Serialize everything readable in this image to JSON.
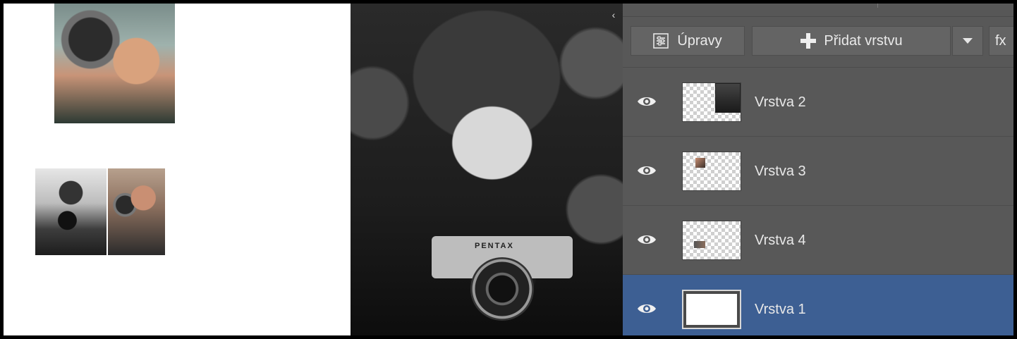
{
  "toolbar": {
    "adjust_label": "Úpravy",
    "add_layer_label": "Přidat vrstvu",
    "fx_label": "fx",
    "icons": [
      "adjustments-icon",
      "plus-icon",
      "chevron-down-icon"
    ]
  },
  "canvas": {
    "collapse_icon": "chevron-left-icon",
    "collapse_glyph": "‹",
    "camera_brand": "PENTAX"
  },
  "layers": [
    {
      "name": "Vrstva 2",
      "visible": true,
      "selected": false
    },
    {
      "name": "Vrstva 3",
      "visible": true,
      "selected": false
    },
    {
      "name": "Vrstva 4",
      "visible": true,
      "selected": false
    },
    {
      "name": "Vrstva 1",
      "visible": true,
      "selected": true
    }
  ],
  "colors": {
    "panel_bg": "#585858",
    "selected_layer_bg": "#3d5f93",
    "button_bg": "#646464",
    "text": "#e8e8e8"
  }
}
